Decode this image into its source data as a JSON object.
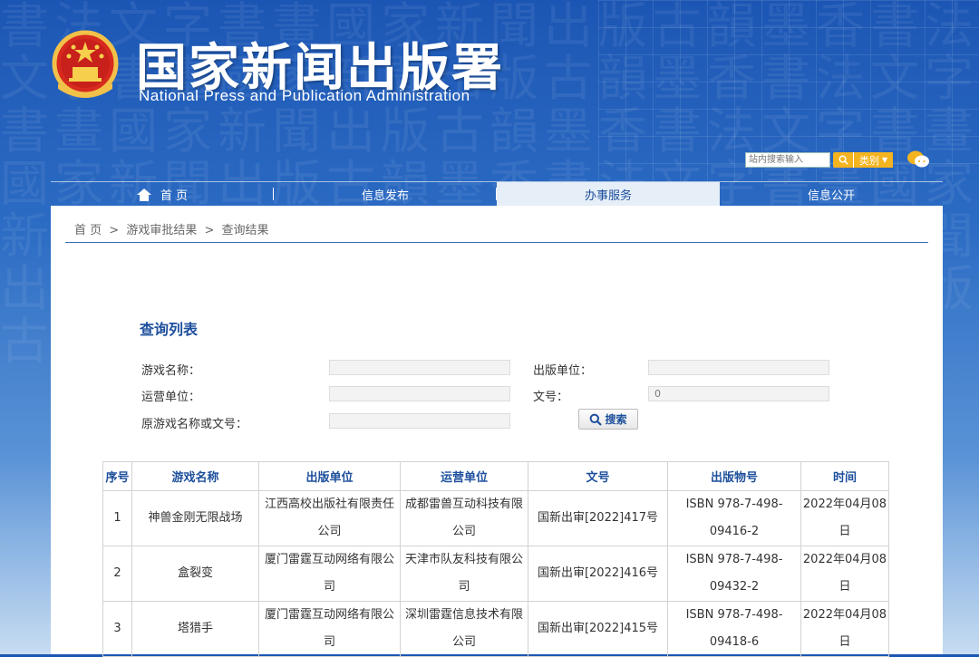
{
  "header": {
    "title": "国家新闻出版署",
    "subtitle": "National  Press and Publication Administration"
  },
  "search": {
    "placeholder": "站内搜索输入",
    "category_label": "类别"
  },
  "nav": {
    "items": [
      {
        "label": "首 页"
      },
      {
        "label": "信息发布"
      },
      {
        "label": "办事服务"
      },
      {
        "label": "信息公开"
      }
    ]
  },
  "breadcrumb": {
    "items": [
      "首 页",
      "游戏审批结果",
      "查询结果"
    ],
    "separator": ">"
  },
  "query": {
    "title": "查询列表",
    "game_name_label": "游戏名称：",
    "publisher_label": "出版单位：",
    "operator_label": "运营单位：",
    "doc_no_label": "文号：",
    "original_label": "原游戏名称或文号：",
    "game_name_value": "",
    "publisher_value": "",
    "operator_value": "",
    "doc_no_value": "0",
    "original_value": "",
    "search_button": "搜索"
  },
  "table": {
    "headers": [
      "序号",
      "游戏名称",
      "出版单位",
      "运营单位",
      "文号",
      "出版物号",
      "时间"
    ],
    "rows": [
      {
        "no": "1",
        "name": "神兽金刚无限战场",
        "publisher": "江西高校出版社有限责任公司",
        "operator": "成都雷兽互动科技有限公司",
        "doc": "国新出审[2022]417号",
        "isbn": "ISBN 978-7-498-09416-2",
        "date": "2022年04月08日"
      },
      {
        "no": "2",
        "name": "盒裂变",
        "publisher": "厦门雷霆互动网络有限公司",
        "operator": "天津市队友科技有限公司",
        "doc": "国新出审[2022]416号",
        "isbn": "ISBN 978-7-498-09432-2",
        "date": "2022年04月08日"
      },
      {
        "no": "3",
        "name": "塔猎手",
        "publisher": "厦门雷霆互动网络有限公司",
        "operator": "深圳雷霆信息技术有限公司",
        "doc": "国新出审[2022]415号",
        "isbn": "ISBN 978-7-498-09418-6",
        "date": "2022年04月08日"
      }
    ]
  },
  "colors": {
    "brand_blue": "#1c56b4",
    "accent_blue": "#1d4f9c",
    "search_orange": "#f3b420"
  }
}
